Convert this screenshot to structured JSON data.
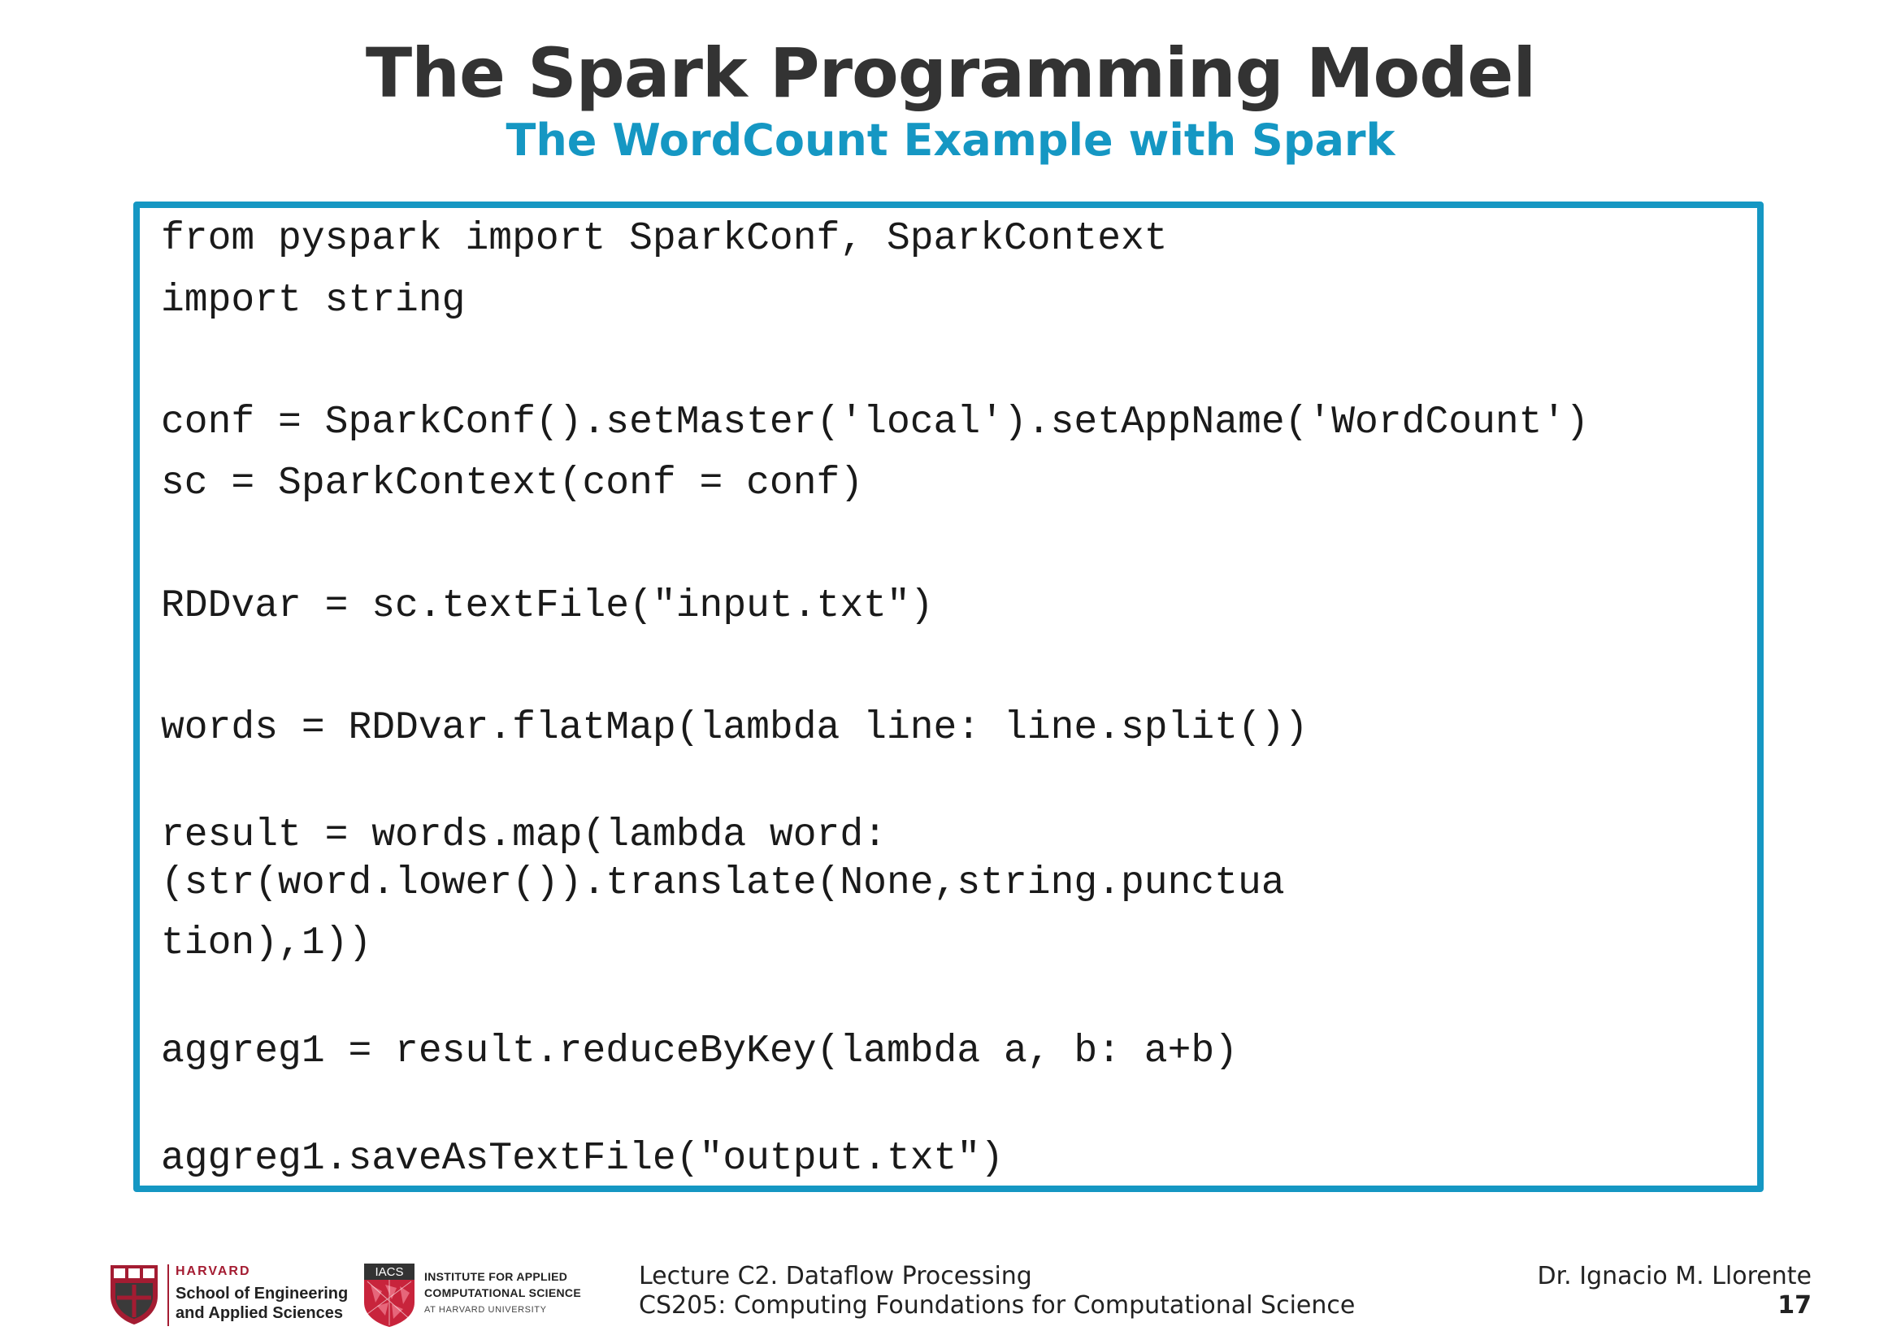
{
  "slide": {
    "title": "The Spark Programming Model",
    "subtitle": "The WordCount Example with Spark"
  },
  "code": {
    "lines": [
      "from pyspark import SparkConf, SparkContext",
      "import string",
      "conf = SparkConf().setMaster('local').setAppName('WordCount')",
      "sc = SparkContext(conf = conf)",
      "RDDvar = sc.textFile(\"input.txt\")",
      "words = RDDvar.flatMap(lambda line: line.split())",
      "result = words.map(lambda word:",
      "(str(word.lower()).translate(None,string.punctua",
      "tion),1))",
      "aggreg1 = result.reduceByKey(lambda a, b: a+b)",
      "aggreg1.saveAsTextFile(\"output.txt\")"
    ]
  },
  "footer": {
    "harvard": {
      "name": "HARVARD",
      "line1": "School of Engineering",
      "line2": "and Applied Sciences"
    },
    "iacs": {
      "badge": "IACS",
      "line1": "INSTITUTE FOR APPLIED",
      "line2": "COMPUTATIONAL SCIENCE",
      "line3": "AT HARVARD UNIVERSITY"
    },
    "lecture": "Lecture C2. Dataflow Processing",
    "course": "CS205: Computing Foundations for Computational Science",
    "author": "Dr. Ignacio M. Llorente",
    "page": "17"
  },
  "colors": {
    "accent": "#1597c3",
    "title": "#333333",
    "harvard_crimson": "#a41c32"
  }
}
